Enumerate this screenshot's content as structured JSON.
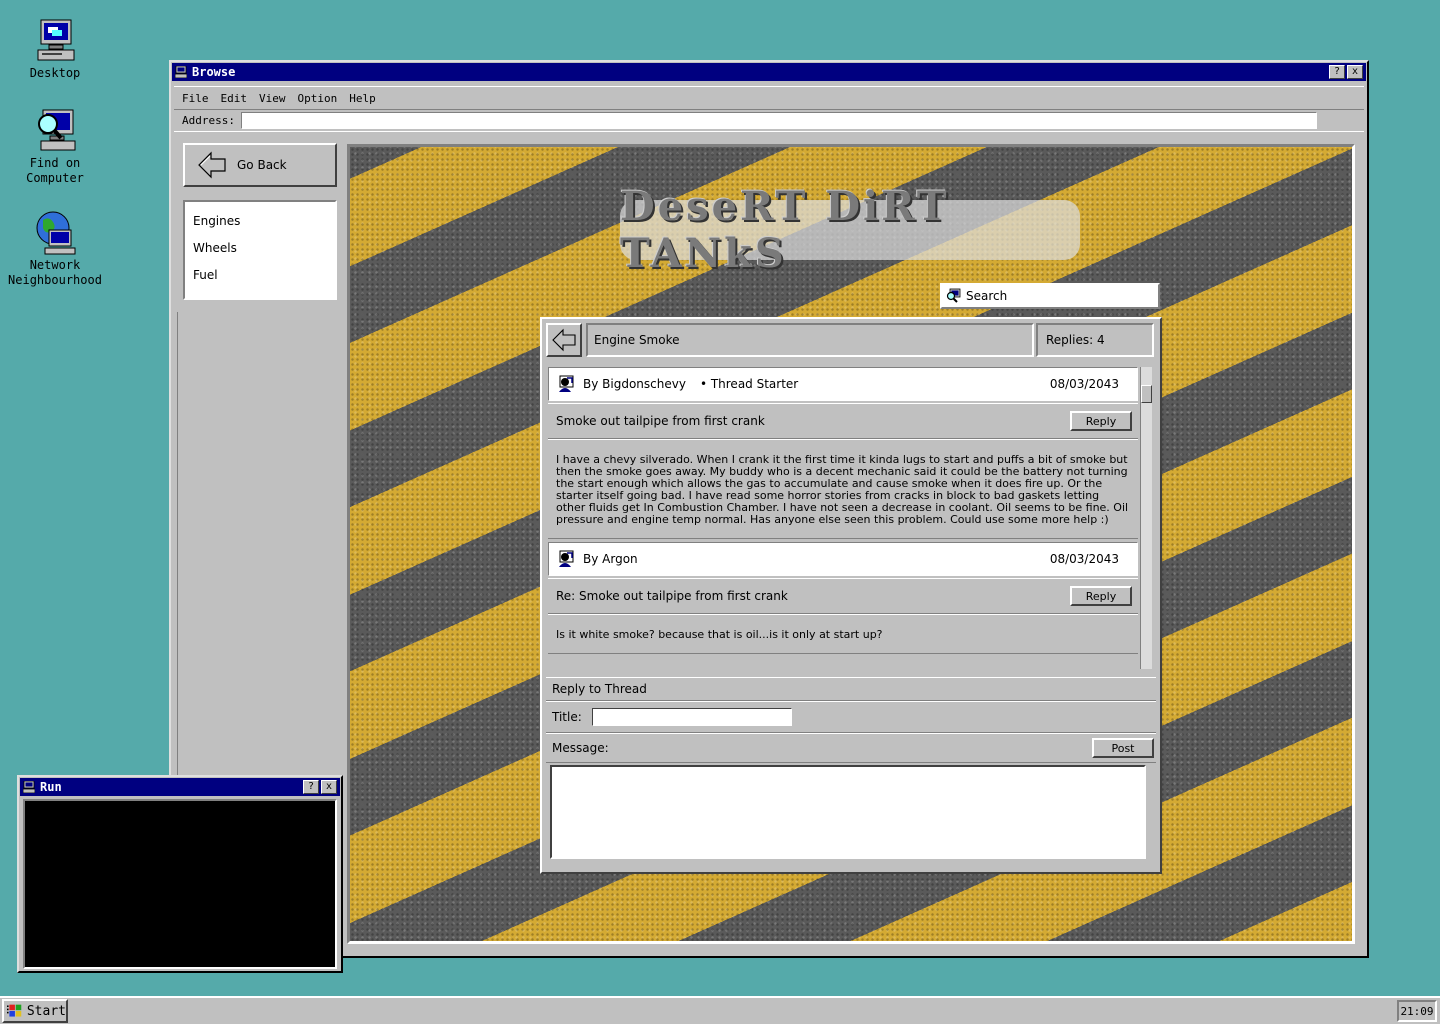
{
  "desktop": {
    "icons": [
      {
        "label": "Desktop"
      },
      {
        "label_line1": "Find on",
        "label_line2": "Computer"
      },
      {
        "label_line1": "Network",
        "label_line2": "Neighbourhood"
      }
    ]
  },
  "browse_window": {
    "title": "Browse",
    "help_btn": "?",
    "close_btn": "x",
    "menu": [
      "File",
      "Edit",
      "View",
      "Option",
      "Help"
    ],
    "address_label": "Address:",
    "address_value": ""
  },
  "sidebar": {
    "go_back": "Go Back",
    "nav": [
      "Engines",
      "Wheels",
      "Fuel"
    ]
  },
  "site": {
    "logo": "DeseRT DiRT TANkS",
    "search_label": "Search"
  },
  "thread": {
    "title": "Engine Smoke",
    "replies": "Replies: 4",
    "posts": [
      {
        "author": "By Bigdonschevy",
        "tag": "• Thread Starter",
        "date": "08/03/2043",
        "subject": "Smoke out tailpipe from first crank",
        "reply_label": "Reply",
        "body": "I have a  chevy silverado. When I crank it the first time it kinda lugs to start and puffs a bit of smoke but then the smoke goes away. My buddy who is a decent mechanic said it could be the battery not turning the start enough which allows the gas to accumulate and cause smoke when it does fire up. Or the starter itself going bad. I have read some horror stories from cracks in block to bad gaskets letting other fluids get In Combustion Chamber. I have not seen a decrease in coolant. Oil seems to be fine. Oil pressure and engine temp normal. Has anyone else seen this problem. Could use some more help :)"
      },
      {
        "author": "By Argon",
        "tag": "",
        "date": "08/03/2043",
        "subject": "Re: Smoke out tailpipe from first crank",
        "reply_label": "Reply",
        "body": "Is it white smoke? because that is oil...is it only at start up?"
      }
    ]
  },
  "reply_form": {
    "heading": "Reply to Thread",
    "title_label": "Title:",
    "title_value": "",
    "message_label": "Message:",
    "post_label": "Post",
    "message_value": ""
  },
  "run_window": {
    "title": "Run",
    "help_btn": "?",
    "close_btn": "x"
  },
  "taskbar": {
    "start_label": "Start",
    "clock": "21:09"
  },
  "colors": {
    "desktop": "#55aaaa",
    "titlebar": "#000080",
    "face": "#c0c0c0"
  }
}
